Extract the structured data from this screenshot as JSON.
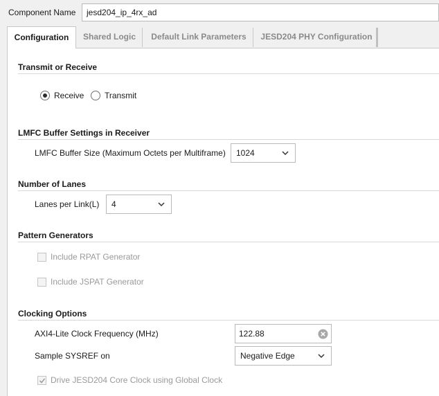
{
  "component": {
    "label": "Component Name",
    "value": "jesd204_ip_4rx_ad"
  },
  "tabs": [
    {
      "label": "Configuration",
      "active": true
    },
    {
      "label": "Shared Logic",
      "active": false
    },
    {
      "label": "Default Link Parameters",
      "active": false
    },
    {
      "label": "JESD204 PHY Configuration",
      "active": false
    }
  ],
  "sections": {
    "transmit_receive": {
      "title": "Transmit or Receive",
      "options": [
        {
          "label": "Receive",
          "selected": true
        },
        {
          "label": "Transmit",
          "selected": false
        }
      ]
    },
    "lmfc": {
      "title": "LMFC Buffer Settings in Receiver",
      "field_label": "LMFC Buffer Size (Maximum Octets per Multiframe)",
      "value": "1024"
    },
    "lanes": {
      "title": "Number of Lanes",
      "field_label": "Lanes per Link(L)",
      "value": "4"
    },
    "pattern": {
      "title": "Pattern Generators",
      "options": [
        {
          "label": "Include RPAT Generator",
          "checked": false,
          "enabled": false
        },
        {
          "label": "Include JSPAT Generator",
          "checked": false,
          "enabled": false
        }
      ]
    },
    "clocking": {
      "title": "Clocking Options",
      "axi_label": "AXI4-Lite Clock Frequency (MHz)",
      "axi_value": "122.88",
      "sysref_label": "Sample SYSREF on",
      "sysref_value": "Negative Edge",
      "global_clock_label": "Drive JESD204 Core Clock using Global Clock",
      "global_clock_checked": true,
      "global_clock_enabled": false
    }
  },
  "icons": {
    "dropdown": "chevron-down-icon",
    "clear": "clear-icon"
  }
}
